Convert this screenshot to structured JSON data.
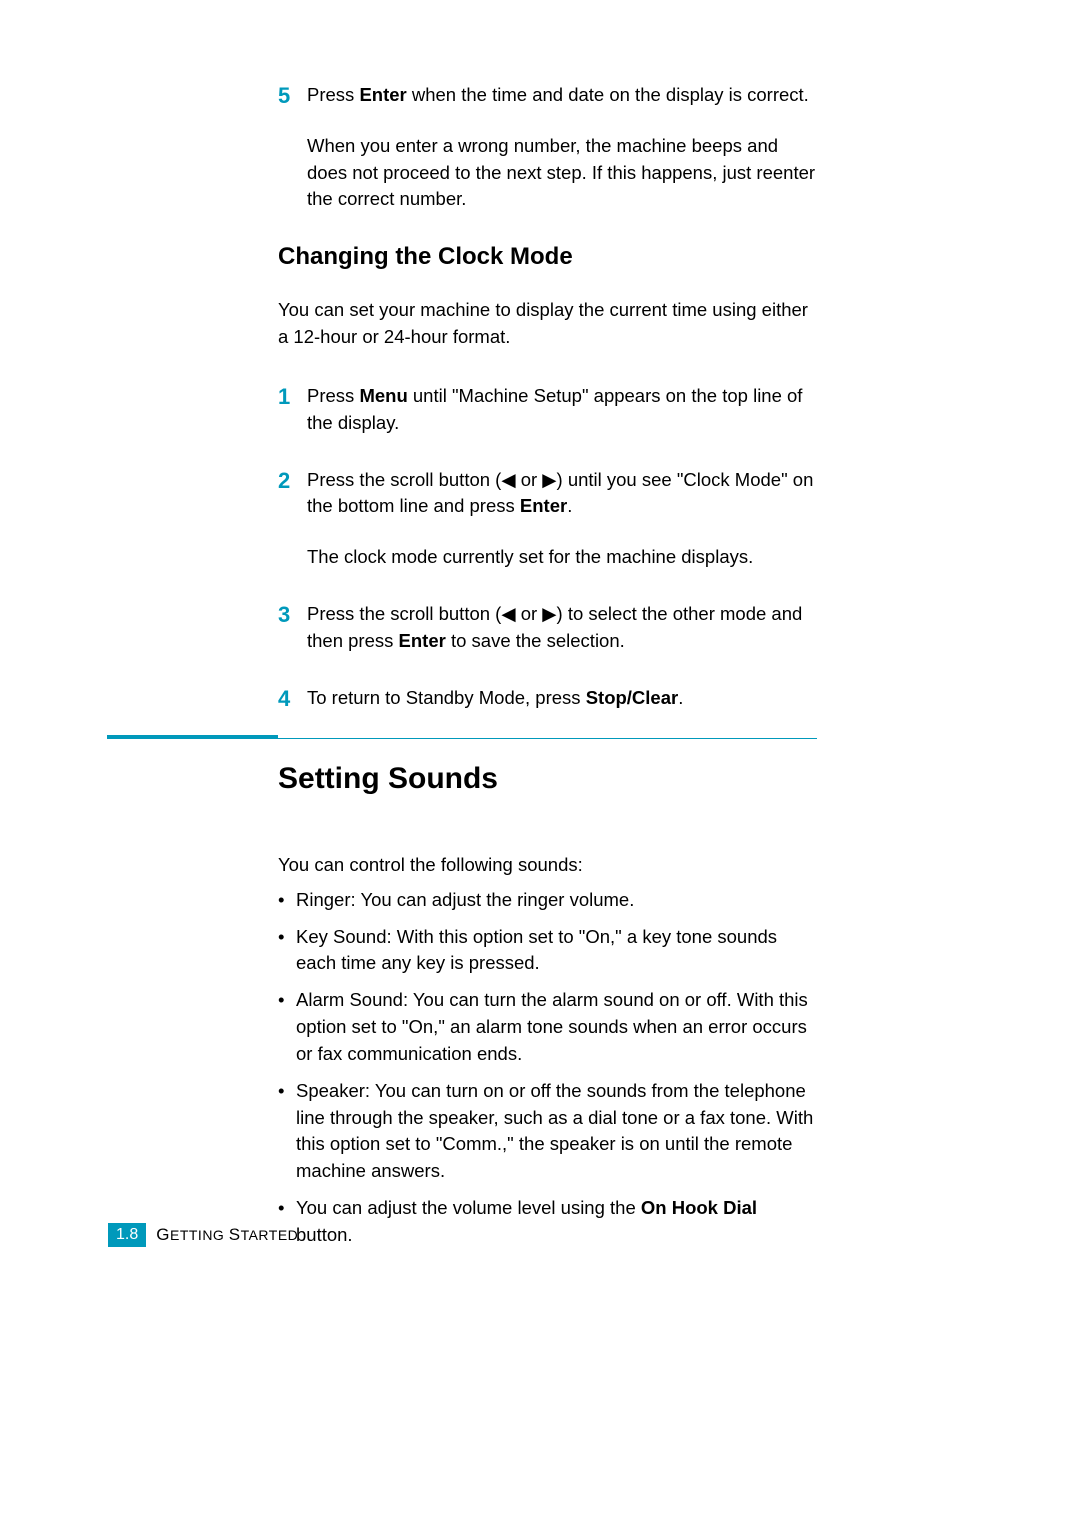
{
  "top_step": {
    "number": "5",
    "text_before_bold": "Press ",
    "bold1": "Enter",
    "text_after_bold": " when the time and date on the display is correct.",
    "para2": "When you enter a wrong number, the machine beeps and does not proceed to the next step. If this happens, just reenter the correct number."
  },
  "subsection_heading": "Changing the Clock Mode",
  "subsection_intro": "You can set your machine to display the current time using either a 12-hour or 24-hour format.",
  "steps": [
    {
      "number": "1",
      "text_before_bold": "Press ",
      "bold": "Menu",
      "text_after_bold": " until \"Machine Setup\" appears on the top line of the display."
    },
    {
      "number": "2",
      "text_before_bold": "Press the scroll button (◀ or ▶) until you see \"Clock Mode\" on the bottom line and press ",
      "bold": "Enter",
      "text_after_bold": ".",
      "para2": "The clock mode currently set for the machine displays."
    },
    {
      "number": "3",
      "text_before_bold": "Press the scroll button (◀ or ▶) to select the other mode and then press ",
      "bold": "Enter",
      "text_after_bold": " to save the selection."
    },
    {
      "number": "4",
      "text_before_bold": "To return to Standby Mode, press ",
      "bold": "Stop/Clear",
      "text_after_bold": "."
    }
  ],
  "section_heading": "Setting Sounds",
  "section_intro": "You can control the following sounds:",
  "bullets": [
    {
      "text": "Ringer: You can adjust the ringer volume."
    },
    {
      "text": "Key Sound: With this option set to \"On,\" a key tone sounds each time any key is pressed."
    },
    {
      "text": "Alarm Sound: You can turn the alarm sound on or off. With this option set to \"On,\" an alarm tone sounds when an error occurs or fax communication ends."
    },
    {
      "text": "Speaker: You can turn on or off the sounds from the telephone line through the speaker, such as a dial tone or a fax tone. With this option set to \"Comm.,\" the speaker is on until the remote machine answers."
    },
    {
      "text_before_bold": "You can adjust the volume level using the ",
      "bold": "On Hook Dial",
      "text_after_bold": " button."
    }
  ],
  "footer": {
    "page_number": "1.8",
    "chapter_first_caps": "G",
    "chapter_rest": "ETTING",
    "chapter2_first_caps": "S",
    "chapter2_rest": "TARTED"
  }
}
